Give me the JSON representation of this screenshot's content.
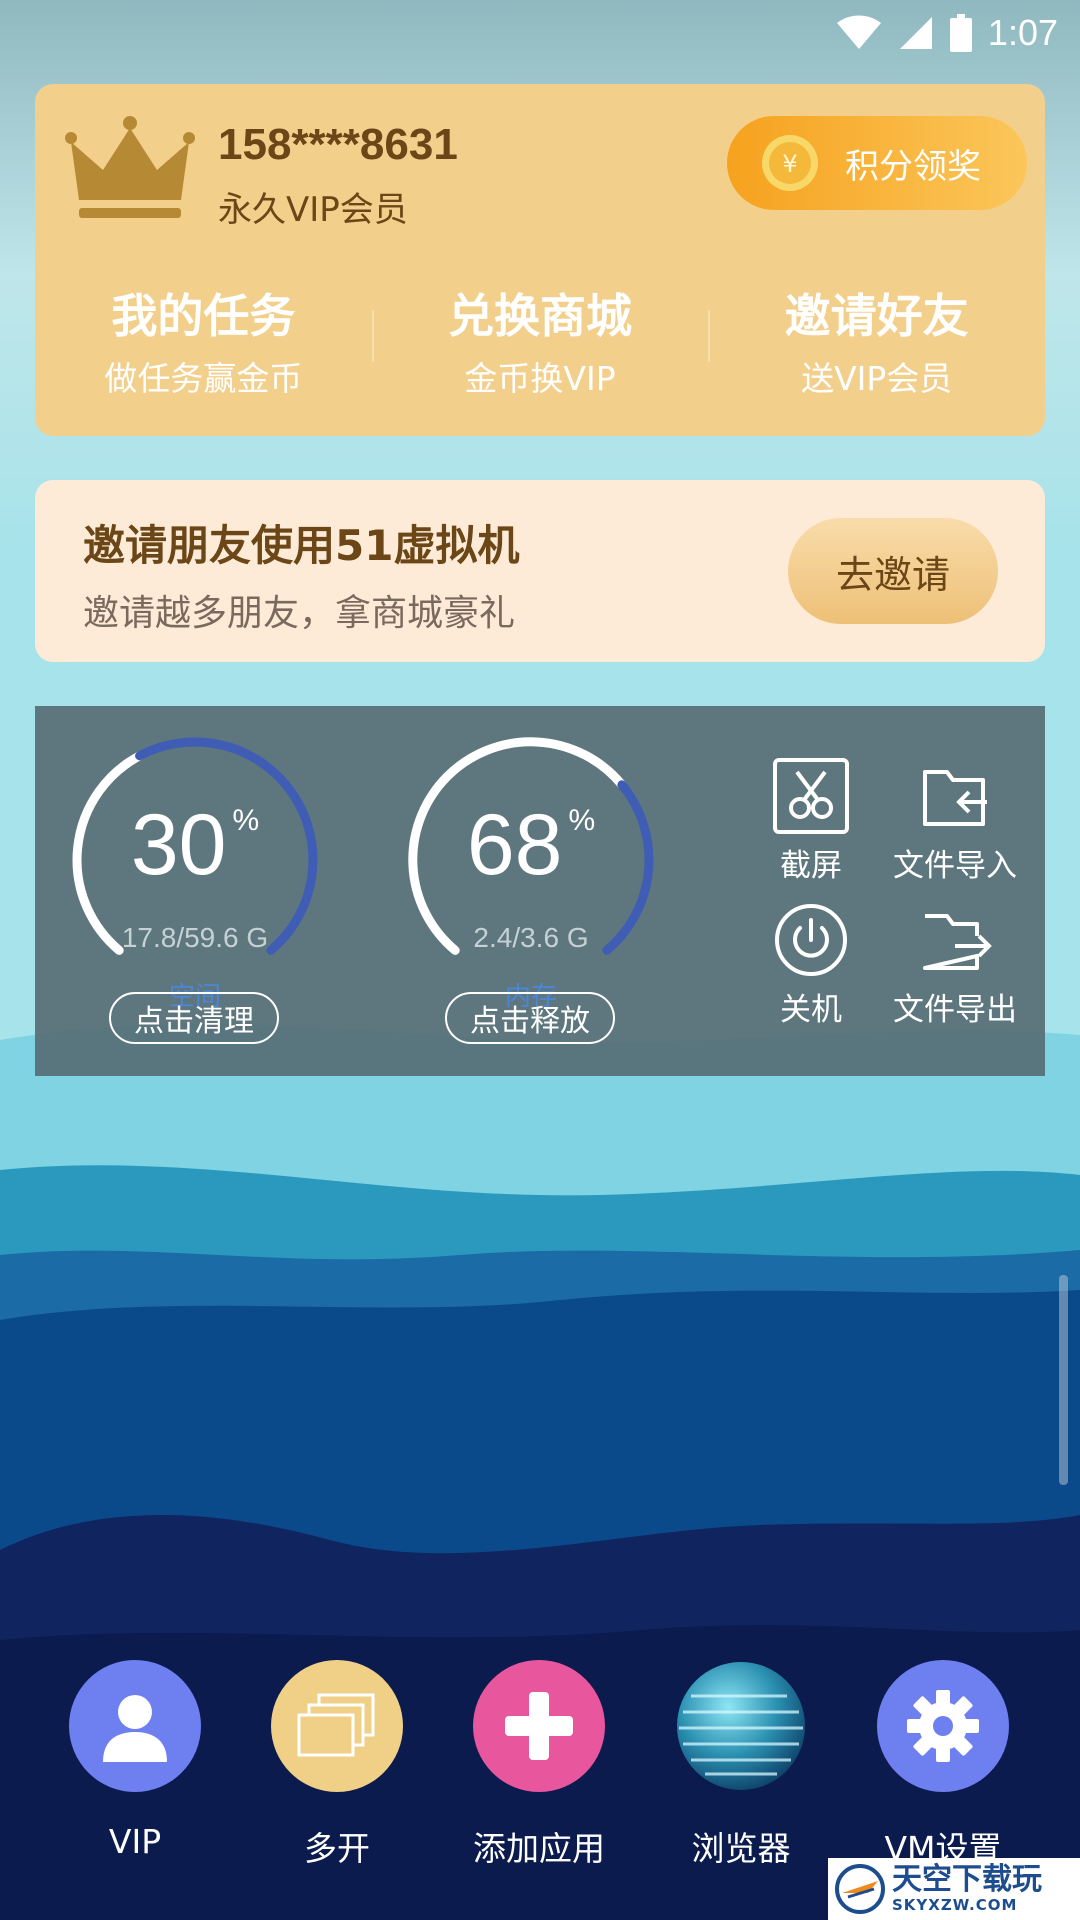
{
  "status_bar": {
    "time": "1:07",
    "icons": [
      "wifi-icon",
      "cell-signal-icon",
      "battery-icon"
    ]
  },
  "vip_card": {
    "phone": "158****8631",
    "level": "永久VIP会员",
    "points_button": "积分领奖",
    "quick_items": [
      {
        "title": "我的任务",
        "subtitle": "做任务赢金币"
      },
      {
        "title": "兑换商城",
        "subtitle": "金币换VIP"
      },
      {
        "title": "邀请好友",
        "subtitle": "送VIP会员"
      }
    ]
  },
  "invite": {
    "title": "邀请朋友使用51虚拟机",
    "subtitle": "邀请越多朋友，拿商城豪礼",
    "button": "去邀请"
  },
  "tools": {
    "storage": {
      "percent": "30",
      "percent_value": 0.3,
      "unit": "%",
      "detail": "17.8/59.6 G",
      "label": "空间",
      "button": "点击清理"
    },
    "memory": {
      "percent": "68",
      "percent_value": 0.68,
      "unit": "%",
      "detail": "2.4/3.6 G",
      "label": "内存",
      "button": "点击释放"
    },
    "actions": [
      {
        "label": "截屏",
        "icon": "scissors-icon"
      },
      {
        "label": "文件导入",
        "icon": "folder-import-icon"
      },
      {
        "label": "关机",
        "icon": "power-icon"
      },
      {
        "label": "文件导出",
        "icon": "folder-export-icon"
      }
    ]
  },
  "dock": [
    {
      "label": "VIP",
      "icon": "user-icon",
      "color": "#6e7ff0"
    },
    {
      "label": "多开",
      "icon": "windows-stack-icon",
      "color": "#f0cf87"
    },
    {
      "label": "添加应用",
      "icon": "plus-icon",
      "color": "#e8569e"
    },
    {
      "label": "浏览器",
      "icon": "globe-icon",
      "color": "#1f6a8a"
    },
    {
      "label": "VM设置",
      "icon": "gear-icon",
      "color": "#6e7ff0"
    }
  ],
  "watermark": {
    "main": "天空下载玩",
    "sub": "SKYXZW.COM"
  }
}
